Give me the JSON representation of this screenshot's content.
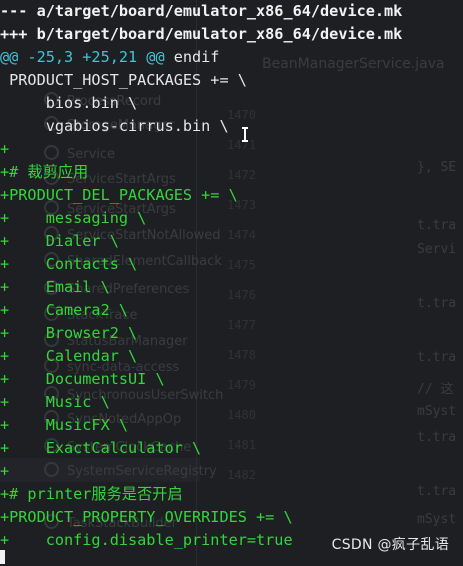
{
  "diff": {
    "lines": [
      {
        "kind": "header",
        "text": "--- a/target/board/emulator_x86_64/device.mk"
      },
      {
        "kind": "header",
        "text": "+++ b/target/board/emulator_x86_64/device.mk"
      },
      {
        "kind": "hunk",
        "text": "@@ -25,3 +25,21 @@",
        "tail": " endif"
      },
      {
        "kind": "ctx",
        "text": " PRODUCT_HOST_PACKAGES += \\"
      },
      {
        "kind": "ctx",
        "text": "     bios.bin \\"
      },
      {
        "kind": "ctx",
        "text": "     vgabios-cirrus.bin \\"
      },
      {
        "kind": "add",
        "text": "+"
      },
      {
        "kind": "add",
        "text": "+# 裁剪应用"
      },
      {
        "kind": "add",
        "text": "+PRODUCT_DEL_PACKAGES += \\"
      },
      {
        "kind": "add",
        "text": "+    messaging \\"
      },
      {
        "kind": "add",
        "text": "+    Dialer \\"
      },
      {
        "kind": "add",
        "text": "+    Contacts \\"
      },
      {
        "kind": "add",
        "text": "+    Email \\"
      },
      {
        "kind": "add",
        "text": "+    Camera2 \\"
      },
      {
        "kind": "add",
        "text": "+    Browser2 \\"
      },
      {
        "kind": "add",
        "text": "+    Calendar \\"
      },
      {
        "kind": "add",
        "text": "+    DocumentsUI \\"
      },
      {
        "kind": "add",
        "text": "+    Music \\"
      },
      {
        "kind": "add",
        "text": "+    MusicFX \\"
      },
      {
        "kind": "add",
        "text": "+    ExactCalculator \\"
      },
      {
        "kind": "add",
        "text": "+"
      },
      {
        "kind": "add",
        "text": "+# printer服务是否开启"
      },
      {
        "kind": "add",
        "text": "+PRODUCT_PROPERTY_OVERRIDES += \\"
      },
      {
        "kind": "add",
        "text": "+    config.disable_printer=true"
      }
    ]
  },
  "background_ide": {
    "tab_title": "BeanManagerService.java",
    "project_items": [
      "ProcessRecord",
      "StorageManager",
      "Service",
      "ServiceStartArgs",
      "ServiceStartArgs",
      "ServiceStartNotAllowed",
      "SharedElementCallback",
      "SharedPreferences",
      "StackTrace",
      "StatusBarManager",
      "sync-data-access",
      "SynchronousUserSwitch",
      "SyncNotedAppOp",
      "SystemClockCache",
      "SystemServiceRegistry",
      "TaskStackBuilder"
    ],
    "line_numbers": [
      "1470",
      "1471",
      "1472",
      "1473",
      "1474",
      "1475",
      "1476",
      "1477",
      "1478",
      "1479",
      "1480",
      "1481",
      "1482"
    ],
    "code_fragments": [
      "}, SE",
      "t.tra",
      "Servi",
      "t.tra",
      "t.tra",
      "// 这",
      "mSyst",
      "t.tra",
      "t.tra",
      "mSyst"
    ]
  },
  "watermark": "CSDN @疯子乱语"
}
